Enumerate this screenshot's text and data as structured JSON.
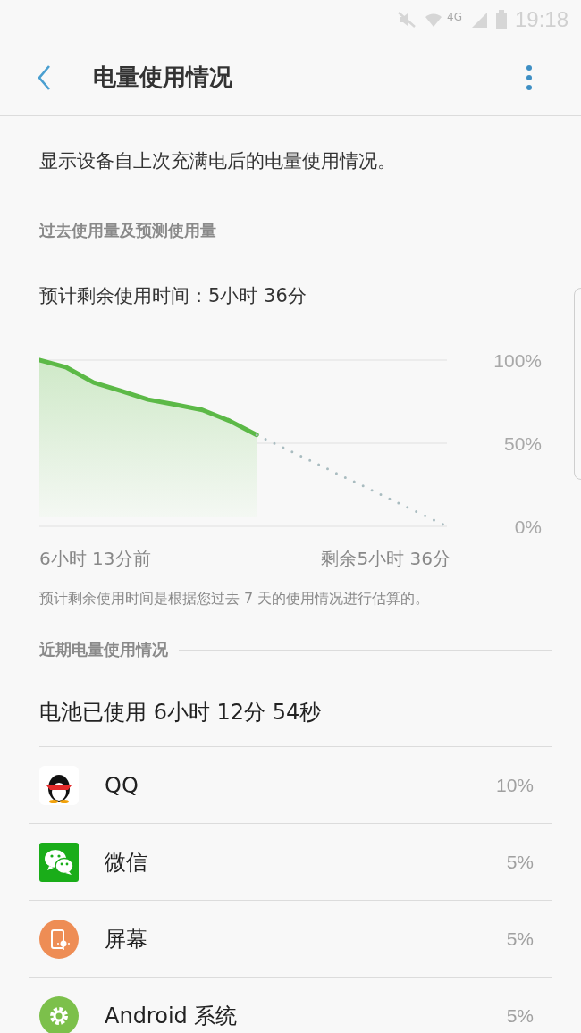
{
  "status_bar": {
    "network": "4G",
    "time": "19:18"
  },
  "toolbar": {
    "title": "电量使用情况"
  },
  "description": "显示设备自上次充满电后的电量使用情况。",
  "history_section": {
    "title": "过去使用量及预测使用量",
    "estimate": "预计剩余使用时间：5小时 36分",
    "chart_data": {
      "type": "line",
      "categories": [
        null,
        null,
        null,
        null,
        null,
        null,
        null,
        null,
        null,
        null,
        null,
        null,
        null,
        null,
        null,
        null
      ],
      "ylim": [
        0,
        100
      ],
      "yticks": [
        {
          "value": 0,
          "label": "0%"
        },
        {
          "value": 50,
          "label": "50%"
        },
        {
          "value": 100,
          "label": "100%"
        }
      ],
      "series": [
        {
          "color": "#5cb947",
          "values": [
            100,
            95.6,
            86.5,
            81.5,
            76.3,
            73.2,
            70,
            63.5,
            55,
            null,
            null,
            null,
            null,
            null,
            null,
            null
          ]
        },
        {
          "color": "#a9bcc0",
          "line_style": "dotted",
          "values": [
            null,
            null,
            null,
            null,
            null,
            null,
            null,
            null,
            55,
            47.1,
            39.3,
            31.4,
            23.6,
            15.7,
            7.9,
            0
          ]
        }
      ]
    },
    "start_label": "6小时 13分前",
    "end_label": "剩余5小时 36分",
    "note": "预计剩余使用时间是根据您过去 7 天的使用情况进行估算的。"
  },
  "recent_section": {
    "title": "近期电量使用情况",
    "total": "电池已使用 6小时 12分 54秒",
    "apps": [
      {
        "kind": "qq",
        "name": "QQ",
        "percent": "10%"
      },
      {
        "kind": "wechat",
        "name": "微信",
        "percent": "5%"
      },
      {
        "kind": "screen",
        "name": "屏幕",
        "percent": "5%"
      },
      {
        "kind": "system",
        "name": "Android 系统",
        "percent": "5%"
      }
    ]
  }
}
